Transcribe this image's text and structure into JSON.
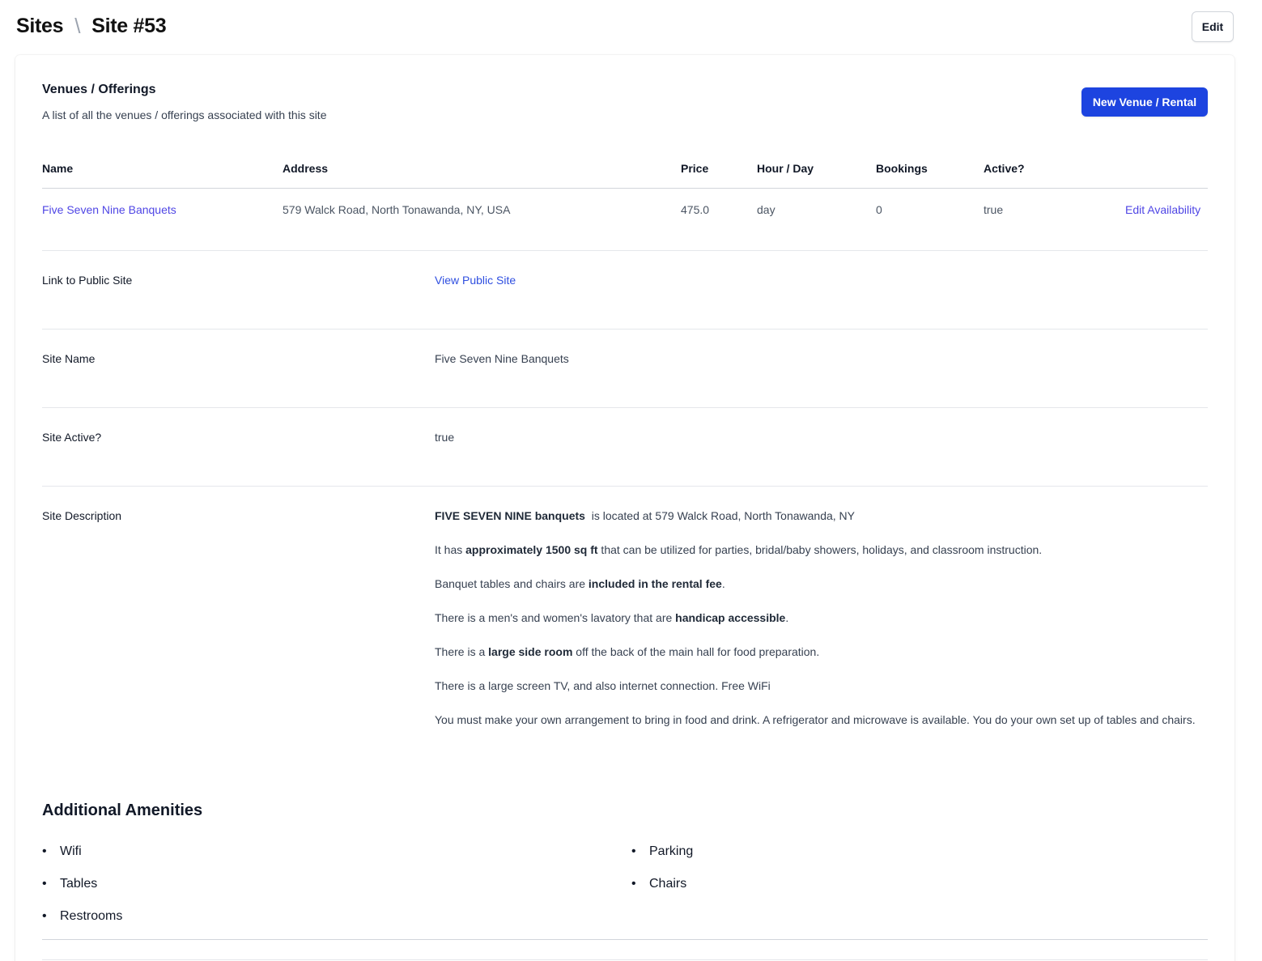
{
  "breadcrumb": {
    "root": "Sites",
    "separator": "\\",
    "current": "Site #53"
  },
  "header": {
    "edit_label": "Edit"
  },
  "venues": {
    "title": "Venues / Offerings",
    "subtitle": "A list of all the venues / offerings associated with this site",
    "new_button": "New Venue / Rental",
    "columns": [
      "Name",
      "Address",
      "Price",
      "Hour / Day",
      "Bookings",
      "Active?"
    ],
    "rows": [
      {
        "name": "Five Seven Nine Banquets",
        "address": "579 Walck Road, North Tonawanda, NY, USA",
        "price": "475.0",
        "hour_day": "day",
        "bookings": "0",
        "active": "true",
        "action": "Edit Availability"
      }
    ]
  },
  "details": {
    "public_link_label": "Link to Public Site",
    "public_link_value": "View Public Site",
    "site_name_label": "Site Name",
    "site_name_value": "Five Seven Nine Banquets",
    "site_active_label": "Site Active?",
    "site_active_value": "true",
    "description_label": "Site Description",
    "description": {
      "p1_bold": "FIVE SEVEN NINE banquets",
      "p1_rest": "is located at 579 Walck Road, North Tonawanda, NY",
      "p2_pre": "It has ",
      "p2_bold": "approximately 1500 sq ft",
      "p2_post": " that can be utilized for parties, bridal/baby showers,  holidays, and classroom instruction.",
      "p3_pre": "Banquet tables and chairs are ",
      "p3_bold": "included in the rental fee",
      "p3_post": ".",
      "p4_pre": "There is a men's and women's lavatory that are ",
      "p4_bold": "handicap accessible",
      "p4_post": ".",
      "p5_pre": "There is a ",
      "p5_bold": "large side room",
      "p5_post": " off the back of the main hall for food preparation.",
      "p6": "There is a large screen TV, and also internet connection. Free WiFi",
      "p7": "You must make your own arrangement to bring in food and drink. A refrigerator and microwave is available. You do your own set up of tables and chairs."
    }
  },
  "amenities": {
    "title": "Additional Amenities",
    "bullet": "•",
    "left": [
      "Wifi",
      "Tables",
      "Restrooms"
    ],
    "right": [
      "Parking",
      "Chairs"
    ]
  }
}
